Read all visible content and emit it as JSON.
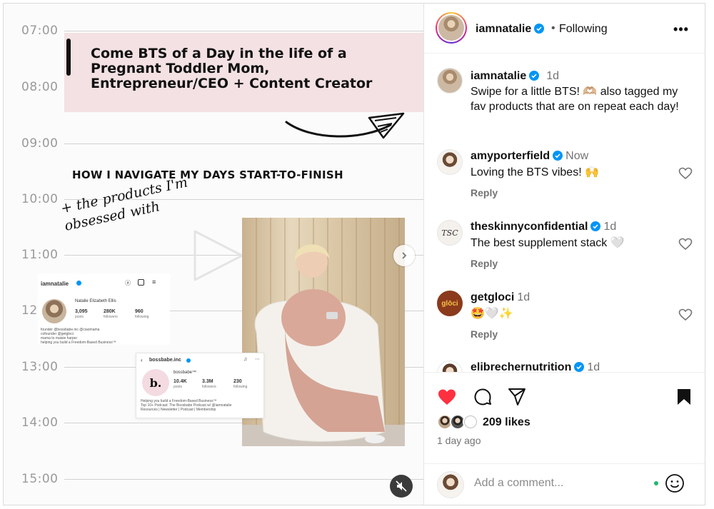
{
  "media": {
    "times": [
      "07:00",
      "08:00",
      "09:00",
      "10:00",
      "11:00",
      "12",
      "13:00",
      "14:00",
      "15:00"
    ],
    "headline": "Come BTS of a Day in the life of a Pregnant Toddler Mom, Entrepreneur/CEO + Content Creator",
    "subhead": "HOW I NAVIGATE MY DAYS START-TO-FINISH",
    "script_text": "+ the products I'm obsessed with",
    "profile_shot": {
      "username": "iamnatalie",
      "name": "Natalie Elizabeth Ellis",
      "posts": "3,095",
      "posts_label": "posts",
      "followers": "280K",
      "followers_label": "followers",
      "following": "960",
      "following_label": "following",
      "bio": [
        "founder @bossbabe.inc @ciaomama",
        "cofounder @getgloci",
        "mama to maisie harper",
        "helping you build a Freedom-Based Business™"
      ]
    },
    "mini_card": {
      "handle": "bossbabe.inc",
      "name": "bossbabe™",
      "logo": "b.",
      "posts": "10.4K",
      "posts_label": "posts",
      "followers": "3.3M",
      "followers_label": "followers",
      "following": "230",
      "following_label": "following",
      "bio": [
        "Helping you build a Freedom-Based Business™",
        "Top 10+ Podcast: The Bossbabe Podcast w/ @iamnatalie",
        "Resources | Newsletter | Podcast | Membership"
      ]
    }
  },
  "header": {
    "username": "iamnatalie",
    "separator": "•",
    "follow_status": "Following",
    "more": "•••"
  },
  "caption": {
    "username": "iamnatalie",
    "time": "1d",
    "text": "Swipe for a little BTS! 🫶🏼 also tagged my fav products that are on repeat each day!"
  },
  "comments": [
    {
      "username": "amyporterfield",
      "time": "Now",
      "text": "Loving the BTS vibes! 🙌",
      "reply": "Reply"
    },
    {
      "username": "theskinnyconfidential",
      "time": "1d",
      "text": "The best supplement stack 🤍",
      "reply": "Reply",
      "avatar_text": "TSC"
    },
    {
      "username": "getgloci",
      "time": "1d",
      "text": "🤩🤍✨",
      "reply": "Reply",
      "avatar_text": "glōci"
    },
    {
      "username": "elibrechernutrition",
      "time": "1d"
    }
  ],
  "actions": {
    "likes": "209 likes",
    "age": "1 day ago"
  },
  "comment_box": {
    "placeholder": "Add a comment..."
  },
  "colors": {
    "heart_red": "#ff3040",
    "verified_blue": "#0095f6",
    "pink_banner": "#f3e1e3"
  }
}
